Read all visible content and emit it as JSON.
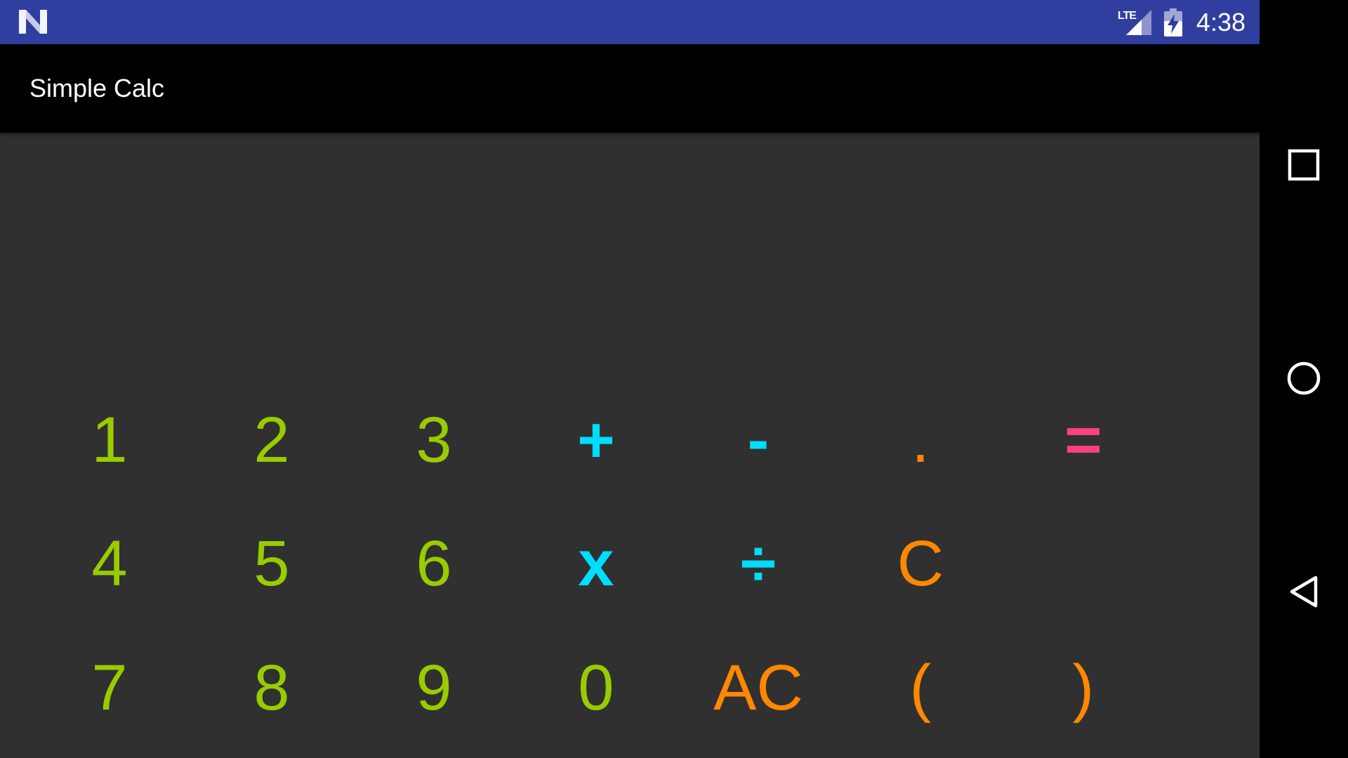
{
  "status_bar": {
    "network": "LTE",
    "time": "4:38",
    "logo_icon": "android-n-icon",
    "signal_icon": "signal-icon",
    "battery_icon": "battery-charging-icon",
    "bg_color": "#303F9F"
  },
  "app_bar": {
    "title": "Simple Calc"
  },
  "display": {
    "value": ""
  },
  "keypad": {
    "row1": [
      "1",
      "2",
      "3",
      "+",
      "-",
      ".",
      "="
    ],
    "row2": [
      "4",
      "5",
      "6",
      "x",
      "÷",
      "C"
    ],
    "row3": [
      "7",
      "8",
      "9",
      "0",
      "AC",
      "(",
      ")"
    ]
  },
  "colors": {
    "digit": "#99CC00",
    "operator": "#00DDFF",
    "control": "#FF8800",
    "equals": "#FF4081",
    "background": "#303030"
  },
  "nav_bar": {
    "recents_icon": "square-icon",
    "home_icon": "circle-icon",
    "back_icon": "triangle-back-icon"
  }
}
